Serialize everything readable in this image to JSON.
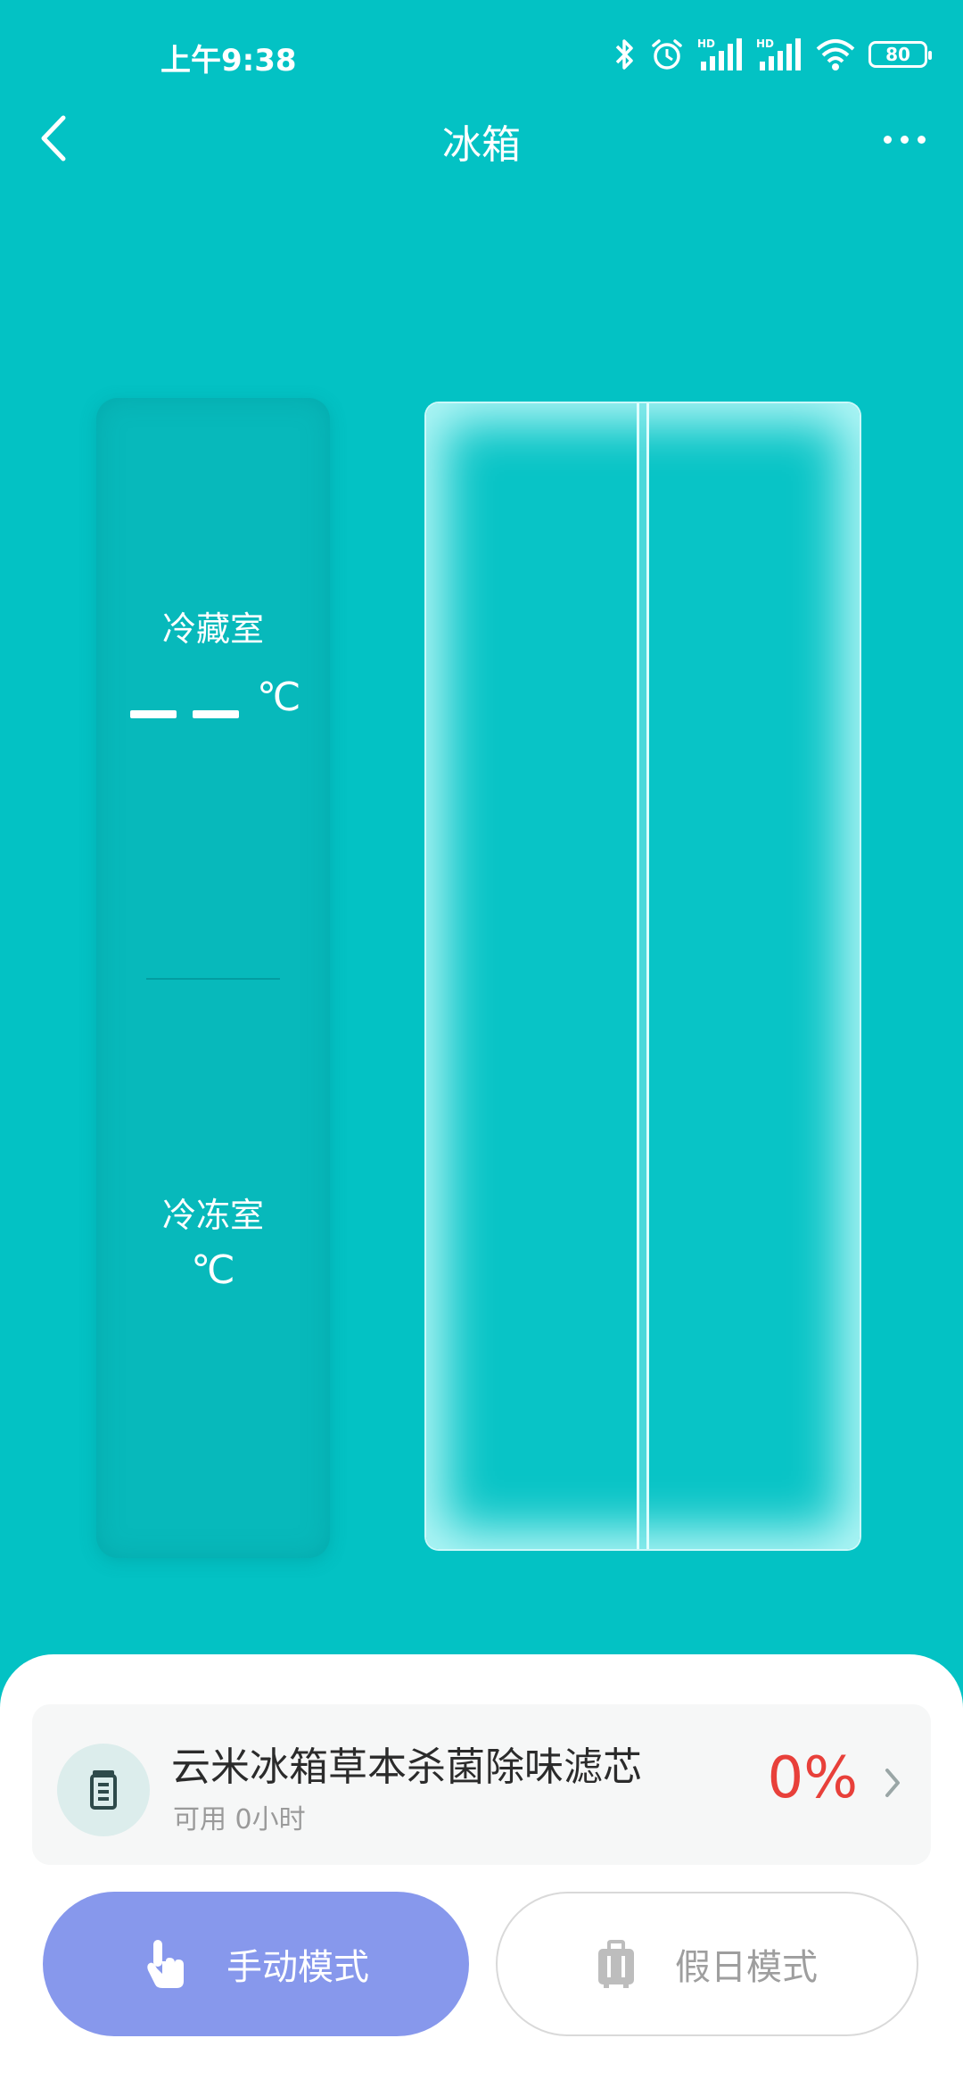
{
  "status_bar": {
    "time": "上午9:38",
    "battery": "80",
    "icons": [
      "bluetooth-icon",
      "alarm-icon",
      "hd-signal-icon",
      "hd-signal-icon",
      "wifi-icon",
      "battery-icon"
    ]
  },
  "header": {
    "title": "冰箱",
    "back_icon": "chevron-left-icon",
    "more_icon": "more-horizontal-icon"
  },
  "temperature": {
    "fridge": {
      "label": "冷藏室",
      "unit": "℃"
    },
    "freezer": {
      "label": "冷冻室",
      "unit": "℃"
    }
  },
  "filter": {
    "name": "云米冰箱草本杀菌除味滤芯",
    "status": "可用 0小时",
    "percent": "0%",
    "percent_color": "#E8403A",
    "icon": "filter-cartridge-icon"
  },
  "modes": {
    "manual": {
      "label": "手动模式",
      "icon": "hand-tap-icon",
      "active": true,
      "color": "#8798EC"
    },
    "holiday": {
      "label": "假日模式",
      "icon": "suitcase-icon",
      "active": false
    }
  },
  "colors": {
    "background": "#03C2C4",
    "panel": "#07B9BB",
    "sheet": "#FFFFFF"
  }
}
